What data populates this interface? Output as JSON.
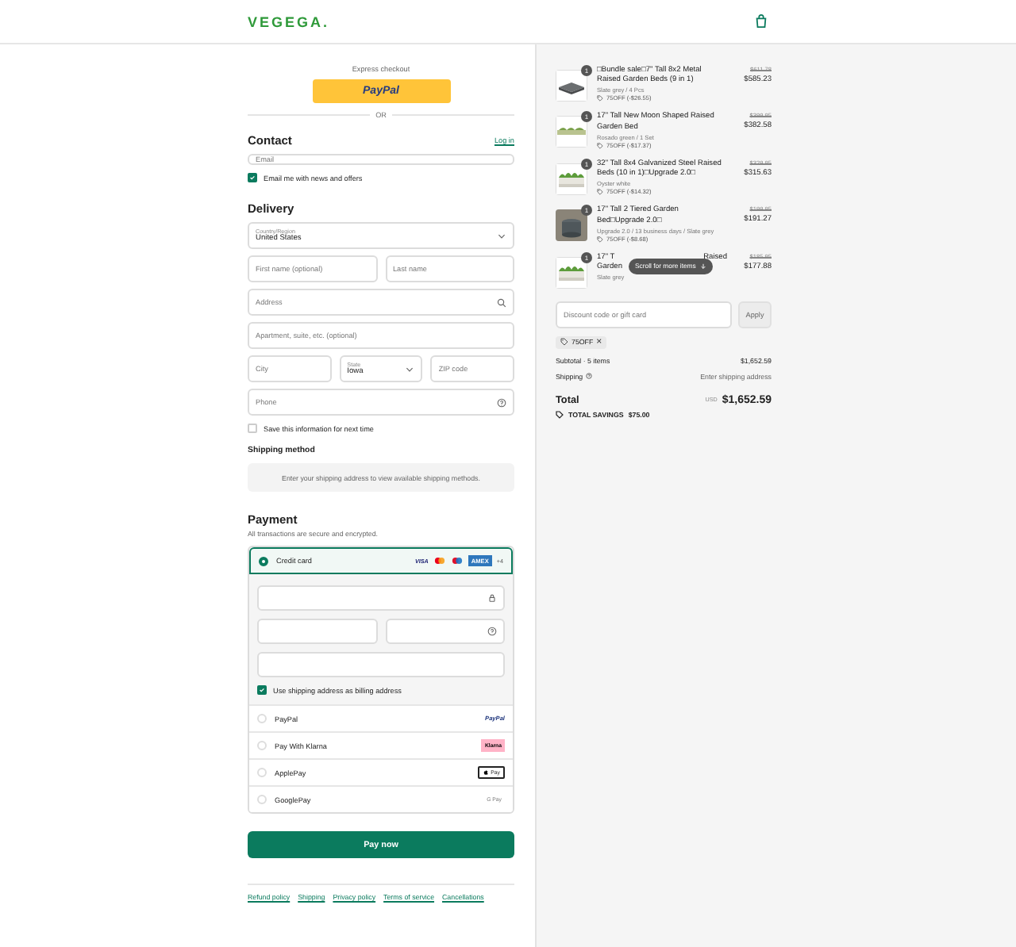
{
  "header": {
    "logo": "VEGEGA."
  },
  "express": {
    "label": "Express checkout",
    "button": "PayPal",
    "divider": "OR"
  },
  "contact": {
    "title": "Contact",
    "link": "Log in",
    "email_placeholder": "Email",
    "newsletter": {
      "label": "Email me with news and offers",
      "checked": true
    }
  },
  "delivery": {
    "title": "Delivery",
    "rows": [
      [
        {
          "kind": "select",
          "label": "Country/Region",
          "value": "United States"
        }
      ],
      [
        {
          "kind": "text",
          "placeholder": "First name (optional)"
        },
        {
          "kind": "text",
          "placeholder": "Last name"
        }
      ],
      [
        {
          "kind": "search",
          "placeholder": "Address"
        }
      ],
      [
        {
          "kind": "text",
          "placeholder": "Apartment, suite, etc. (optional)"
        }
      ],
      [
        {
          "kind": "text",
          "placeholder": "City"
        },
        {
          "kind": "select",
          "label": "State",
          "value": "Iowa"
        },
        {
          "kind": "text",
          "placeholder": "ZIP code"
        }
      ],
      [
        {
          "kind": "help",
          "placeholder": "Phone"
        }
      ]
    ],
    "save": {
      "label": "Save this information for next time",
      "checked": false
    }
  },
  "shipping": {
    "title": "Shipping method",
    "note": "Enter your shipping address to view available shipping methods."
  },
  "payment": {
    "title": "Payment",
    "subtitle": "All transactions are secure and encrypted.",
    "methods": [
      {
        "kind": "card",
        "label": "Credit card",
        "selected": true,
        "logos": [
          {
            "kind": "visa",
            "text": "VISA"
          },
          {
            "kind": "mastercard"
          },
          {
            "kind": "maestro"
          },
          {
            "kind": "amex",
            "text": "AMEX"
          }
        ],
        "more": "+4"
      },
      {
        "kind": "paypal",
        "label": "PayPal",
        "selected": false,
        "logo": "PayPal"
      },
      {
        "kind": "klarna",
        "label": "Pay With Klarna",
        "selected": false,
        "logo": "Klarna"
      },
      {
        "kind": "applepay",
        "label": "ApplePay",
        "selected": false,
        "logo": "Pay"
      },
      {
        "kind": "googlepay",
        "label": "GooglePay",
        "selected": false,
        "logo": "G Pay"
      }
    ],
    "billing": {
      "label": "Use shipping address as billing address",
      "checked": true
    },
    "pay_button": "Pay now"
  },
  "footer_links": [
    "Refund policy",
    "Shipping",
    "Privacy policy",
    "Terms of service",
    "Cancellations"
  ],
  "cart": {
    "items": [
      {
        "qty": "1",
        "title": [
          "□Bundle sale□7\" Tall 8x2 Metal Raised Garden Beds (9 in 1)"
        ],
        "variant": "Slate grey / 4 Pcs",
        "discount": "75OFF (-$26.55)",
        "old_price": "$611.78",
        "price": "$585.23"
      },
      {
        "qty": "1",
        "title": [
          "17\" Tall New Moon Shaped Raised Garden Bed"
        ],
        "variant": "Rosado green / 1 Set",
        "discount": "75OFF (-$17.37)",
        "old_price": "$399.95",
        "price": "$382.58"
      },
      {
        "qty": "1",
        "title": [
          "32\" Tall 8x4 Galvanized Steel Raised Beds (10 in 1)□Upgrade 2.0□"
        ],
        "variant": "Oyster white",
        "discount": "75OFF (-$14.32)",
        "old_price": "$329.95",
        "price": "$315.63"
      },
      {
        "qty": "1",
        "title": [
          "17\" Tall 2 Tiered Garden Bed□Upgrade 2.0□"
        ],
        "variant": "Upgrade 2.0 / 13 business days / Slate grey",
        "discount": "75OFF (-$8.68)",
        "old_price": "$199.95",
        "price": "$191.27"
      },
      {
        "qty": "1",
        "title": [
          "17\" T",
          "Raised",
          "Garden"
        ],
        "variant": "Slate grey",
        "old_price": "$185.95",
        "price": "$177.88"
      }
    ],
    "scroll_hint": "Scroll for more items",
    "discount_placeholder": "Discount code or gift card",
    "apply": "Apply",
    "code": "75OFF",
    "remove": "×",
    "subtotal_label": "Subtotal · 5 items",
    "subtotal": "$1,652.59",
    "shipping_label": "Shipping",
    "shipping_value": "Enter shipping address",
    "total_label": "Total",
    "currency": "USD",
    "total": "$1,652.59",
    "savings_label": "TOTAL SAVINGS",
    "savings": "$75.00"
  }
}
